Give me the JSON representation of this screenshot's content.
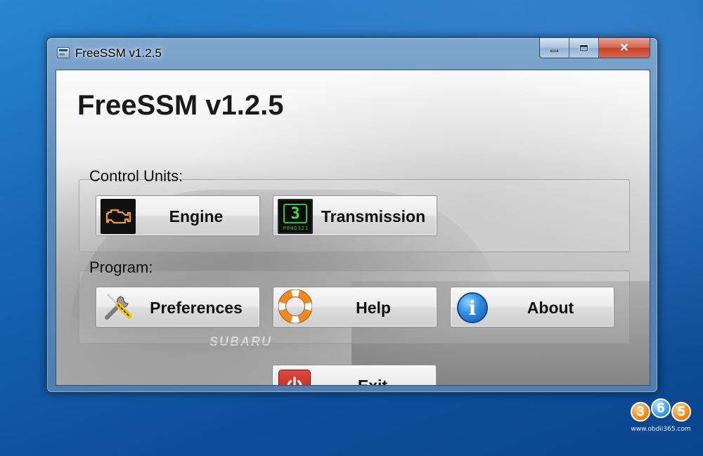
{
  "window": {
    "title": "FreeSSM v1.2.5",
    "caption_buttons": [
      "minimize",
      "maximize",
      "close"
    ]
  },
  "app": {
    "heading": "FreeSSM v1.2.5"
  },
  "control_units": {
    "label": "Control Units:",
    "buttons": [
      {
        "label": "Engine",
        "icon": "engine-warning-icon"
      },
      {
        "label": "Transmission",
        "icon": "gear-display-icon"
      }
    ],
    "gear_display": {
      "digit": "3",
      "indicator": "PRND321"
    }
  },
  "program": {
    "label": "Program:",
    "buttons": [
      {
        "label": "Preferences",
        "icon": "wrench-screwdriver-icon"
      },
      {
        "label": "Help",
        "icon": "lifebuoy-icon"
      },
      {
        "label": "About",
        "icon": "info-icon"
      }
    ],
    "about_glyph": "i"
  },
  "exit": {
    "label": "Exit",
    "icon": "power-icon"
  },
  "background": {
    "badge": "SUBARU"
  },
  "watermark": {
    "digits": [
      "3",
      "6",
      "5"
    ],
    "url": "www.obdii365.com"
  },
  "colors": {
    "desktop": "#1766b4",
    "engine_icon": "#f2a11f",
    "transmission_icon": "#3de050",
    "exit_icon": "#c32a21",
    "about_icon": "#2f8be0"
  }
}
